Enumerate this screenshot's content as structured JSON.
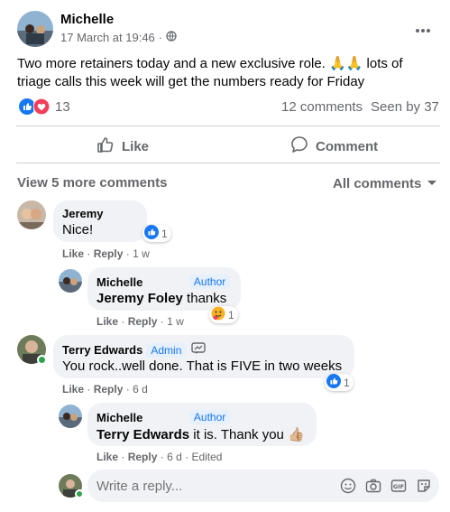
{
  "post": {
    "author": "Michelle",
    "date": "17 March at 19:46",
    "separator": "·",
    "text_line1": "Two more retainers today and a new exclusive role. 🙏🙏 lots of",
    "text_line2": "triage calls this week will get the numbers ready for Friday",
    "reaction_count": "13",
    "comments_count": "12 comments",
    "seen_by": "Seen by 37",
    "like_label": "Like",
    "comment_label": "Comment"
  },
  "comments_header": {
    "view_more": "View 5 more comments",
    "filter": "All comments"
  },
  "comments": [
    {
      "name": "Jeremy",
      "text": "Nice!",
      "reactions": "1",
      "like": "Like",
      "reply": "Reply",
      "time": "1 w",
      "dot": "·"
    },
    {
      "name": "Michelle",
      "badge": "Author",
      "tag": "Jeremy Foley",
      "text": " thanks",
      "reactions": "1",
      "like": "Like",
      "reply": "Reply",
      "time": "1 w",
      "dot": "·"
    },
    {
      "name": "Terry Edwards",
      "badge": "Admin",
      "text": "You rock..well done. That is FIVE in two weeks",
      "reactions": "1",
      "like": "Like",
      "reply": "Reply",
      "time": "6 d",
      "dot": "·"
    },
    {
      "name": "Michelle",
      "badge": "Author",
      "tag": "Terry Edwards",
      "text": " it is. Thank you 👍🏼",
      "like": "Like",
      "reply": "Reply",
      "time": "6 d",
      "edited": "Edited",
      "dot": "·"
    }
  ],
  "reply_box": {
    "placeholder": "Write a reply..."
  },
  "icons": {
    "more": "more-icon",
    "globe": "globe-icon",
    "like": "like-icon",
    "love": "love-icon",
    "comment": "comment-icon",
    "chevron": "chevron-down-icon",
    "admin": "admin-badge-icon",
    "emoji": "emoji-icon",
    "camera": "camera-icon",
    "gif": "gif-icon",
    "sticker": "sticker-icon"
  },
  "colors": {
    "accent": "#1877f2",
    "love": "#f33e58",
    "text": "#050505",
    "secondary": "#65676b",
    "bubble": "#f0f2f5",
    "online": "#31a24c"
  }
}
